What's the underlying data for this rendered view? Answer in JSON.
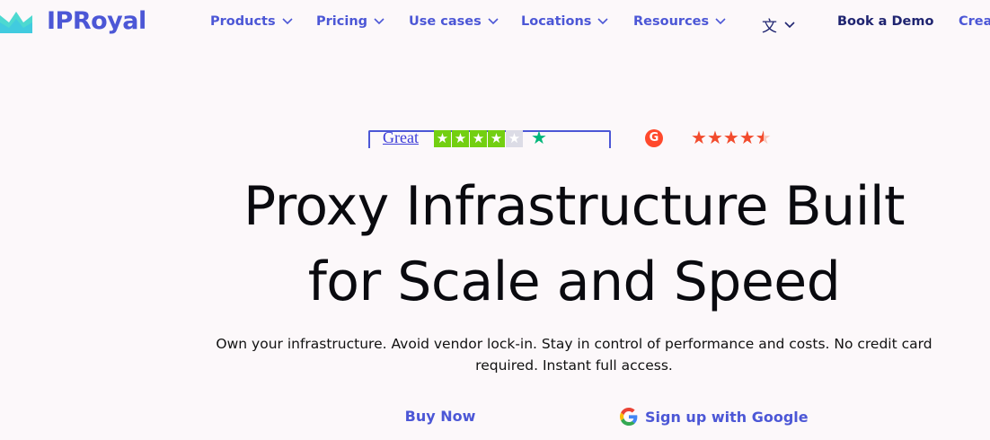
{
  "nav": {
    "brand": "IPRoyal",
    "items": [
      {
        "label": "Products"
      },
      {
        "label": "Pricing"
      },
      {
        "label": "Use cases"
      },
      {
        "label": "Locations"
      },
      {
        "label": "Resources"
      }
    ],
    "language_icon": "translate-icon",
    "book_demo": "Book a Demo",
    "create_account": "Crea"
  },
  "ratings": {
    "trustpilot": {
      "label": "Great",
      "stars_filled": 4,
      "stars_total": 5,
      "star_color": "#73cf11",
      "brand_star_color": "#00b67a"
    },
    "g2": {
      "icon_letter": "G",
      "stars_value": 4.5,
      "star_color": "#f24b2d"
    }
  },
  "hero": {
    "title_line1": "Proxy Infrastructure Built",
    "title_line2": "for Scale and Speed",
    "subtitle_line1": "Own your infrastructure. Avoid vendor lock-in. Stay in control of performance and costs. No credit card",
    "subtitle_line2": "required. Instant full access.",
    "buy_now": "Buy Now",
    "google_signup": "Sign up with Google"
  },
  "colors": {
    "brand": "#4c57d6",
    "brand_dark": "#1f2470",
    "background": "#fcf8fa"
  }
}
